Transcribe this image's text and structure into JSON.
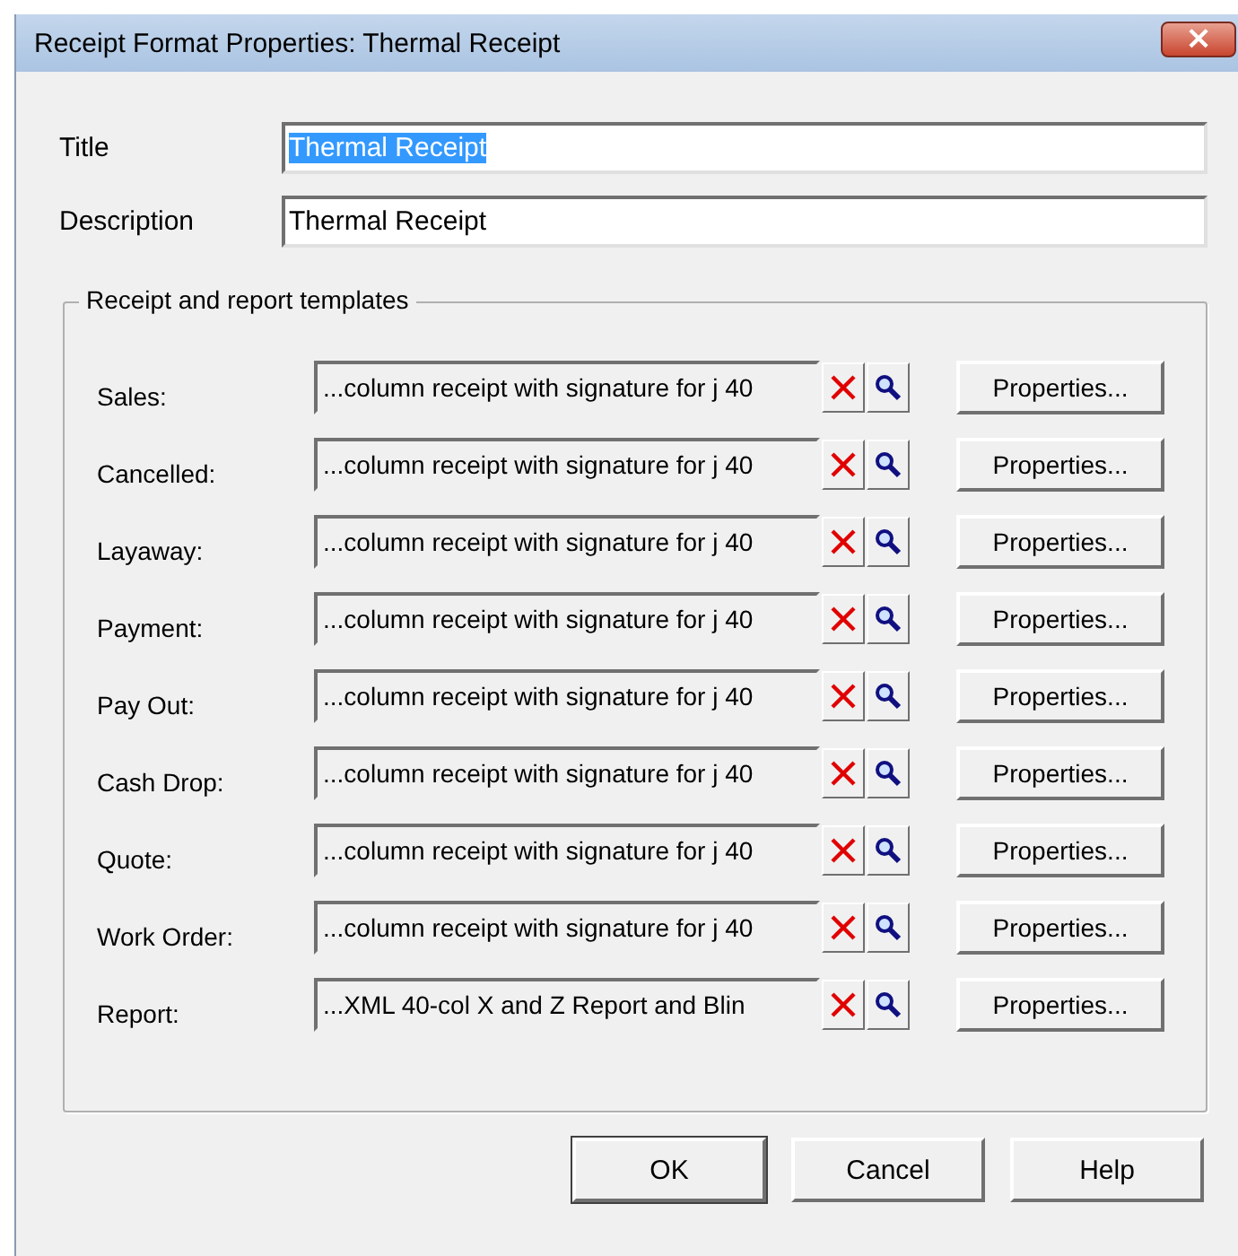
{
  "window": {
    "title": "Receipt Format Properties: Thermal Receipt",
    "close": "×"
  },
  "fields": [
    {
      "label": "Title",
      "value": "Thermal Receipt",
      "selected": true
    },
    {
      "label": "Description",
      "value": "Thermal Receipt",
      "selected": false
    }
  ],
  "group": {
    "title": "Receipt and report templates",
    "rows": [
      {
        "label": "Sales:",
        "value": "...column receipt with signature for j 40",
        "button": "Properties..."
      },
      {
        "label": "Cancelled:",
        "value": "...column receipt with signature for j 40",
        "button": "Properties..."
      },
      {
        "label": "Layaway:",
        "value": "...column receipt with signature for j 40",
        "button": "Properties..."
      },
      {
        "label": "Payment:",
        "value": "...column receipt with signature for j 40",
        "button": "Properties..."
      },
      {
        "label": "Pay Out:",
        "value": "...column receipt with signature for j 40",
        "button": "Properties..."
      },
      {
        "label": "Cash Drop:",
        "value": "...column receipt with signature for j 40",
        "button": "Properties..."
      },
      {
        "label": "Quote:",
        "value": "...column receipt with signature for j 40",
        "button": "Properties..."
      },
      {
        "label": "Work Order:",
        "value": "...column receipt with signature for j 40",
        "button": "Properties..."
      },
      {
        "label": "Report:",
        "value": "...XML 40-col X and Z Report and Blin",
        "button": "Properties..."
      }
    ]
  },
  "buttons": [
    "OK",
    "Cancel",
    "Help"
  ]
}
